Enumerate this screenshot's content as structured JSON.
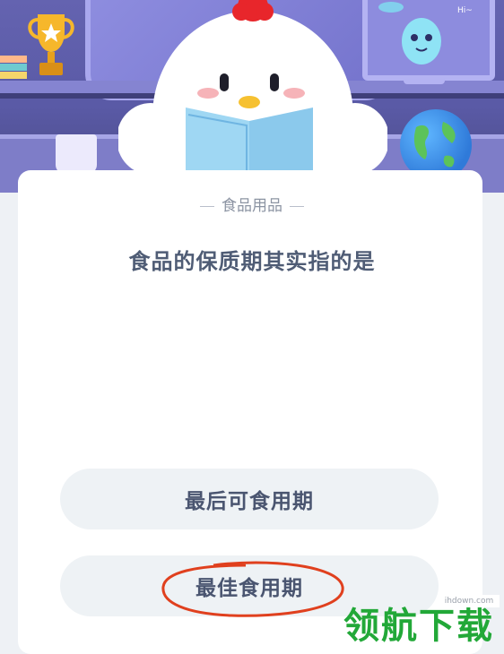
{
  "category": "食品用品",
  "question": "食品的保质期其实指的是",
  "options": [
    {
      "label": "最后可食用期"
    },
    {
      "label": "最佳食用期",
      "marked": true
    }
  ],
  "illustration": {
    "speech_bubble": "Hi~"
  },
  "watermark": {
    "text": "领航下载",
    "url": "ihdown.com"
  },
  "colors": {
    "card": "#ffffff",
    "option_bg": "#eef2f5",
    "question_text": "#4f5c75",
    "circle_mark": "#e0401e",
    "watermark": "#22a838"
  }
}
